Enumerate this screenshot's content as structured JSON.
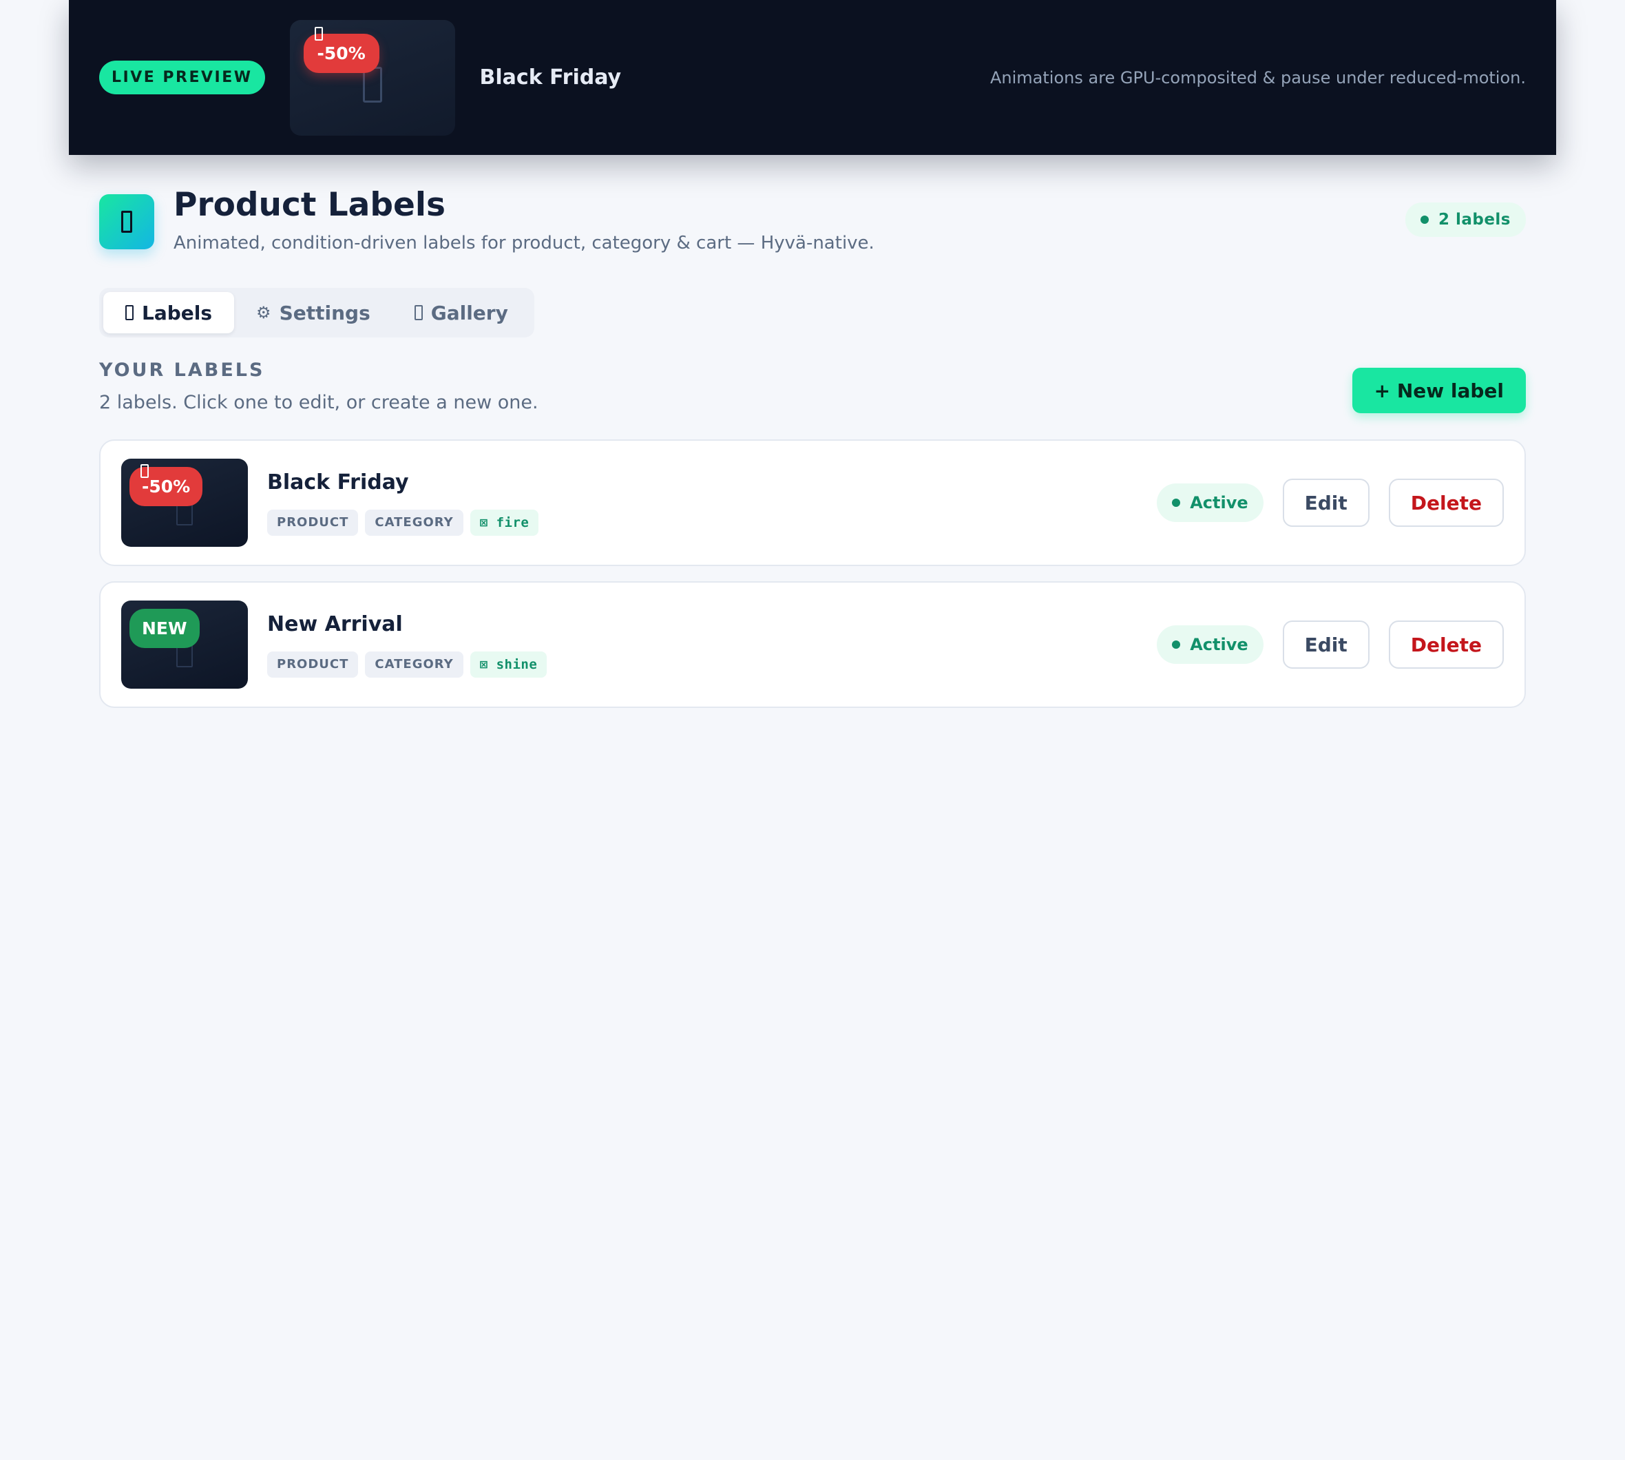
{
  "preview": {
    "pill_label": "LIVE PREVIEW",
    "badge_text": "-50%",
    "badge_color": "#e23b3b",
    "label_name": "Black Friday",
    "note": "Animations are GPU-composited & pause under reduced-motion."
  },
  "header": {
    "title": "Product Labels",
    "subtitle": "Animated, condition-driven labels for product, category & cart — Hyvä-native.",
    "count": "2 labels",
    "icon": "tag-icon"
  },
  "tabs": [
    {
      "label": "Labels",
      "icon": "tag-icon",
      "active": true
    },
    {
      "label": "Settings",
      "icon": "gear-icon",
      "active": false
    },
    {
      "label": "Gallery",
      "icon": "gallery-icon",
      "active": false
    }
  ],
  "section": {
    "title": "YOUR LABELS",
    "description": "2 labels. Click one to edit, or create a new one.",
    "new_button": "+ New label"
  },
  "labels": [
    {
      "name": "Black Friday",
      "badge_text": "-50%",
      "badge_color": "#e23b3b",
      "scopes": [
        "PRODUCT",
        "CATEGORY"
      ],
      "animation": "fire",
      "status": "Active",
      "edit_label": "Edit",
      "delete_label": "Delete"
    },
    {
      "name": "New Arrival",
      "badge_text": "NEW",
      "badge_color": "#1f9a57",
      "scopes": [
        "PRODUCT",
        "CATEGORY"
      ],
      "animation": "shine",
      "status": "Active",
      "edit_label": "Edit",
      "delete_label": "Delete"
    }
  ],
  "colors": {
    "accent": "#19e6a1",
    "active_status": "#12906a",
    "delete": "#c4161c",
    "preview_bg": "#0b1120"
  }
}
